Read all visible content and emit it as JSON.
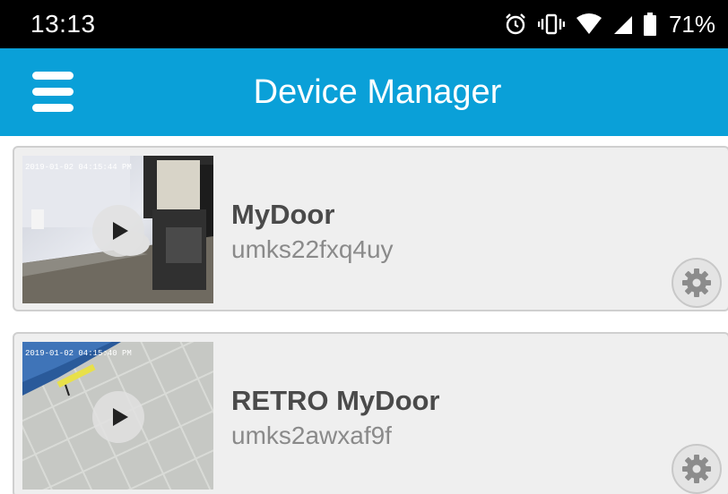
{
  "status_bar": {
    "time": "13:13",
    "battery": "71%",
    "icons": [
      "alarm-icon",
      "vibrate-icon",
      "wifi-icon",
      "signal-icon",
      "battery-icon"
    ]
  },
  "app_bar": {
    "title": "Device Manager",
    "background_color": "#0aa0d8",
    "menu_icon": "hamburger-menu-icon"
  },
  "devices": [
    {
      "name": "MyDoor",
      "uid": "umks22fxq4uy",
      "thumbnail_timestamp": "2019-01-02 04:15:44 PM",
      "actions": [
        "play-icon",
        "gear-icon"
      ]
    },
    {
      "name": "RETRO MyDoor",
      "uid": "umks2awxaf9f",
      "thumbnail_timestamp": "2019-01-02 04:15:40 PM",
      "actions": [
        "play-icon",
        "gear-icon"
      ]
    }
  ]
}
